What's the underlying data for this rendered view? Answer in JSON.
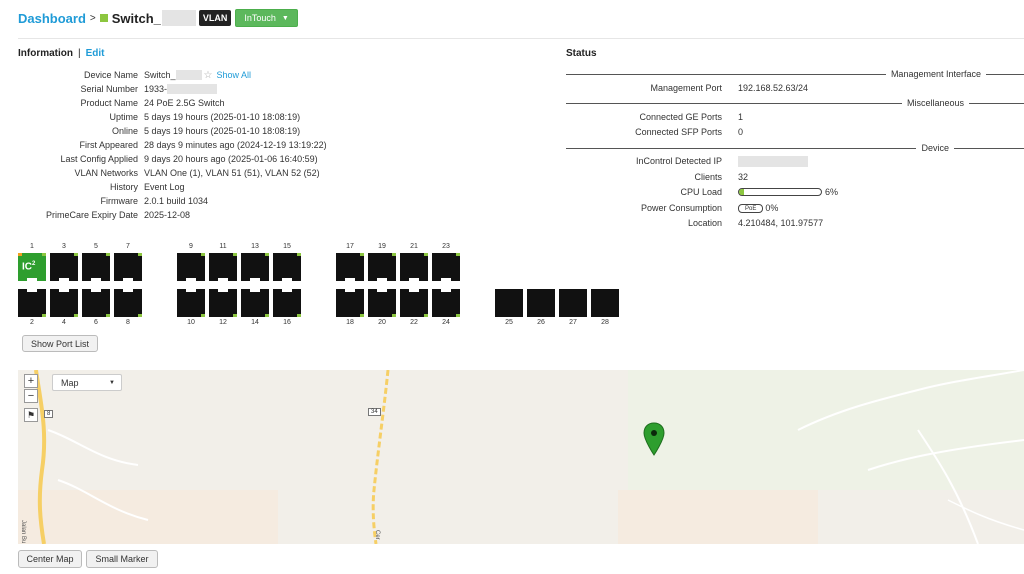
{
  "header": {
    "breadcrumb_root": "Dashboard",
    "separator": ">",
    "device_title": "Switch_",
    "vlan_badge": "VLAN",
    "intouch_label": "InTouch"
  },
  "info": {
    "heading": "Information",
    "divider": "|",
    "edit_label": "Edit",
    "rows": [
      {
        "key": "Device Name",
        "value": "Switch_"
      },
      {
        "key": "Serial Number",
        "value": "1933-"
      },
      {
        "key": "Product Name",
        "value": "24 PoE 2.5G Switch"
      },
      {
        "key": "Uptime",
        "value": "5 days 19 hours (2025-01-10 18:08:19)"
      },
      {
        "key": "Online",
        "value": "5 days 19 hours (2025-01-10 18:08:19)"
      },
      {
        "key": "First Appeared",
        "value": "28 days 9 minutes ago (2024-12-19 13:19:22)"
      },
      {
        "key": "Last Config Applied",
        "value": "9 days 20 hours ago (2025-01-06 16:40:59)"
      },
      {
        "key": "VLAN Networks",
        "value": "VLAN One (1), VLAN 51 (51), VLAN 52 (52)"
      },
      {
        "key": "History",
        "value": "Event Log"
      },
      {
        "key": "Firmware",
        "value": "2.0.1 build 1034"
      },
      {
        "key": "PrimeCare Expiry Date",
        "value": "2025-12-08"
      }
    ],
    "star_glyph": "☆",
    "show_all_label": "Show All"
  },
  "status": {
    "heading": "Status",
    "sections": {
      "mgmt": "Management Interface",
      "misc": "Miscellaneous",
      "device": "Device"
    },
    "management_port_label": "Management Port",
    "management_port_value": "192.168.52.63/24",
    "ge_ports_label": "Connected GE Ports",
    "ge_ports_value": "1",
    "sfp_ports_label": "Connected SFP Ports",
    "sfp_ports_value": "0",
    "incontrol_ip_label": "InControl Detected IP",
    "clients_label": "Clients",
    "clients_value": "32",
    "cpu_label": "CPU Load",
    "cpu_value": "6%",
    "cpu_fraction": 0.06,
    "power_label": "Power Consumption",
    "power_badge": "PoE",
    "power_value": "0%",
    "location_label": "Location",
    "location_value": "4.210484, 101.97577"
  },
  "ports": {
    "top_numbers": [
      "1",
      "3",
      "5",
      "7",
      "9",
      "11",
      "13",
      "15",
      "17",
      "19",
      "21",
      "23"
    ],
    "bottom_numbers": [
      "2",
      "4",
      "6",
      "8",
      "10",
      "12",
      "14",
      "16",
      "18",
      "20",
      "22",
      "24",
      "25",
      "26",
      "27",
      "28"
    ],
    "active_port": "1",
    "active_logo": "IC",
    "active_logo_sup": "2",
    "show_port_list_label": "Show Port List"
  },
  "map": {
    "zoom_in": "+",
    "zoom_out": "−",
    "type_selected": "Map",
    "road_labels": [
      "8",
      "34"
    ],
    "street_label_1": "Jalan Bu",
    "street_label_2": "Cer",
    "marker_color": "#2e9e2e",
    "center_map_label": "Center Map",
    "small_marker_label": "Small Marker"
  },
  "colors": {
    "link": "#1f9bd7",
    "online": "#8cc63f",
    "intouch": "#5cb85c"
  }
}
